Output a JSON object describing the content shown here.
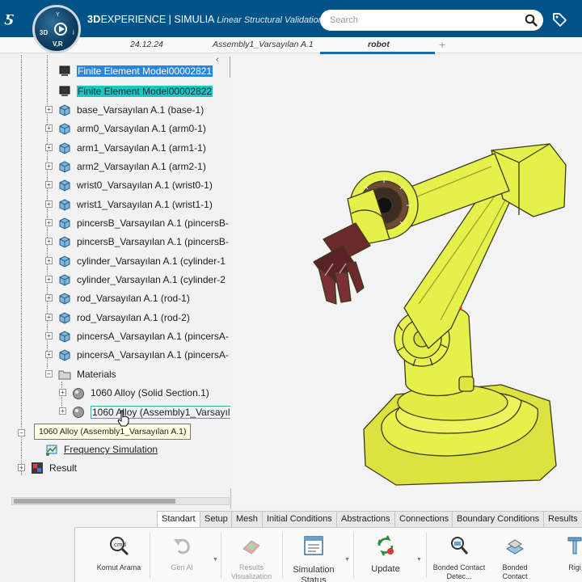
{
  "header": {
    "brand": "3DEXPERIENCE | SIMULIA",
    "brand_prefix": "3D",
    "brand_mid": "EXPERIENCE | SIMULIA",
    "app_name": "Linear Structural Validation",
    "compass_top": "Y",
    "compass_3d": "3D",
    "compass_vr": "V,R",
    "compass_i": "i",
    "search_placeholder": "Search"
  },
  "tabs": [
    {
      "label": "24.12.24"
    },
    {
      "label": "Assembly1_Varsayılan A.1"
    },
    {
      "label": "robot"
    }
  ],
  "tab_add": "+",
  "tree": {
    "collapse_glyph": "‹",
    "rows": [
      {
        "label": "Finite Element Model00002821"
      },
      {
        "label": "Finite Element Model00002822"
      },
      {
        "label": "base_Varsayılan A.1 (base-1)"
      },
      {
        "label": "arm0_Varsayılan A.1 (arm0-1)"
      },
      {
        "label": "arm1_Varsayılan A.1 (arm1-1)"
      },
      {
        "label": "arm2_Varsayılan A.1 (arm2-1)"
      },
      {
        "label": "wrist0_Varsayılan A.1 (wrist0-1)"
      },
      {
        "label": "wrist1_Varsayılan A.1 (wrist1-1)"
      },
      {
        "label": "pincersB_Varsayılan A.1 (pincersB-"
      },
      {
        "label": "pincersB_Varsayılan A.1 (pincersB-"
      },
      {
        "label": "cylinder_Varsayılan A.1 (cylinder-1"
      },
      {
        "label": "cylinder_Varsayılan A.1 (cylinder-2"
      },
      {
        "label": "rod_Varsayılan A.1 (rod-1)"
      },
      {
        "label": "rod_Varsayılan A.1 (rod-2)"
      },
      {
        "label": "pincersA_Varsayılan A.1 (pincersA-"
      },
      {
        "label": "pincersA_Varsayılan A.1 (pincersA-"
      },
      {
        "label": "Materials"
      },
      {
        "label": "1060 Alloy (Solid Section.1)"
      },
      {
        "label": "1060 Alloy (Assembly1_Varsayıl"
      },
      {
        "label": "Frequency Simulation"
      },
      {
        "label": "Result"
      }
    ],
    "tooltip": "1060 Alloy (Assembly1_Varsayılan A.1)"
  },
  "action_tabs": [
    "Standart",
    "Setup",
    "Mesh",
    "Initial Conditions",
    "Abstractions",
    "Connections",
    "Boundary Conditions",
    "Results"
  ],
  "commands": [
    {
      "label": "Komut Arama"
    },
    {
      "label": "Geri Al"
    },
    {
      "label": "Results Visualization"
    },
    {
      "label": "Simulation Status"
    },
    {
      "label": "Update"
    },
    {
      "label": "Bonded Contact Detec..."
    },
    {
      "label": "Bonded Contact"
    },
    {
      "label": "Rigi"
    }
  ],
  "colors": {
    "topbar": "#005386",
    "selection_blue": "#2b86d9",
    "selection_teal": "#20c4c4",
    "robot_yellow": "#e6f04a",
    "gripper": "#6b2a2e"
  },
  "icons": {
    "search": "search-icon",
    "tag": "tag-icon",
    "part": "part-icon",
    "material": "material-sphere-icon",
    "folder": "folder-icon",
    "simulation": "simulation-icon",
    "result": "result-icon"
  }
}
